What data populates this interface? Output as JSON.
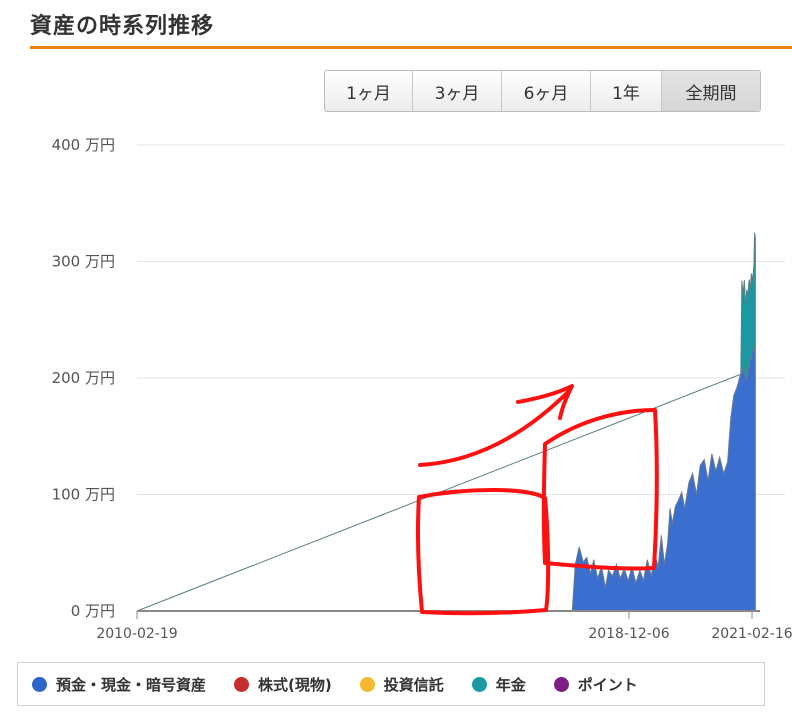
{
  "page": {
    "title": "資産の時系列推移"
  },
  "range_selector": {
    "options": [
      {
        "label": "1ヶ月",
        "active": false
      },
      {
        "label": "3ヶ月",
        "active": false
      },
      {
        "label": "6ヶ月",
        "active": false
      },
      {
        "label": "1年",
        "active": false
      },
      {
        "label": "全期間",
        "active": true
      }
    ]
  },
  "legend": {
    "items": [
      {
        "label": "預金・現金・暗号資産",
        "color": "#2f64c8"
      },
      {
        "label": "株式(現物)",
        "color": "#c62d2d"
      },
      {
        "label": "投資信託",
        "color": "#f5b82e"
      },
      {
        "label": "年金",
        "color": "#1a9aa0"
      },
      {
        "label": "ポイント",
        "color": "#7a1f86"
      }
    ]
  },
  "chart_data": {
    "type": "area",
    "stacked": true,
    "y_unit": "万円",
    "ylim": [
      0,
      400
    ],
    "y_ticks": [
      {
        "value": 0,
        "label": "0 万円"
      },
      {
        "value": 100,
        "label": "100 万円"
      },
      {
        "value": 200,
        "label": "200 万円"
      },
      {
        "value": 300,
        "label": "300 万円"
      },
      {
        "value": 400,
        "label": "400 万円"
      }
    ],
    "x_ticks": [
      "2010-02-19",
      "2018-12-06",
      "2021-02-16"
    ],
    "xlim": [
      "2010-02-19",
      "2021-03-10"
    ],
    "grid": true,
    "series": [
      {
        "name": "預金・現金・暗号資産",
        "color": "#3a6fcf",
        "points": [
          [
            "2010-02-19",
            0
          ],
          [
            "2017-12-01",
            0
          ],
          [
            "2017-12-20",
            40
          ],
          [
            "2018-01-15",
            55
          ],
          [
            "2018-02-10",
            42
          ],
          [
            "2018-03-05",
            46
          ],
          [
            "2018-03-30",
            32
          ],
          [
            "2018-04-20",
            44
          ],
          [
            "2018-05-15",
            28
          ],
          [
            "2018-06-10",
            38
          ],
          [
            "2018-07-05",
            20
          ],
          [
            "2018-07-25",
            35
          ],
          [
            "2018-08-20",
            30
          ],
          [
            "2018-09-15",
            40
          ],
          [
            "2018-10-10",
            28
          ],
          [
            "2018-11-05",
            36
          ],
          [
            "2018-12-01",
            26
          ],
          [
            "2018-12-25",
            38
          ],
          [
            "2019-01-20",
            24
          ],
          [
            "2019-02-15",
            35
          ],
          [
            "2019-03-10",
            26
          ],
          [
            "2019-04-05",
            44
          ],
          [
            "2019-04-30",
            30
          ],
          [
            "2019-05-25",
            48
          ],
          [
            "2019-06-15",
            38
          ],
          [
            "2019-07-05",
            65
          ],
          [
            "2019-07-25",
            40
          ],
          [
            "2019-08-15",
            58
          ],
          [
            "2019-08-31",
            88
          ],
          [
            "2019-09-15",
            75
          ],
          [
            "2019-10-05",
            90
          ],
          [
            "2019-10-25",
            95
          ],
          [
            "2019-11-15",
            102
          ],
          [
            "2019-12-05",
            88
          ],
          [
            "2020-01-01",
            110
          ],
          [
            "2020-01-25",
            118
          ],
          [
            "2020-02-20",
            100
          ],
          [
            "2020-03-15",
            125
          ],
          [
            "2020-04-10",
            130
          ],
          [
            "2020-05-05",
            112
          ],
          [
            "2020-05-30",
            135
          ],
          [
            "2020-06-25",
            120
          ],
          [
            "2020-07-20",
            132
          ],
          [
            "2020-08-15",
            118
          ],
          [
            "2020-09-10",
            128
          ],
          [
            "2020-09-30",
            165
          ],
          [
            "2020-10-20",
            185
          ],
          [
            "2020-11-10",
            192
          ],
          [
            "2020-12-01",
            202
          ],
          [
            "2020-12-20",
            208
          ],
          [
            "2021-01-10",
            198
          ],
          [
            "2021-01-30",
            212
          ],
          [
            "2021-02-16",
            222
          ],
          [
            "2021-03-10",
            228
          ]
        ]
      },
      {
        "name": "年金",
        "color": "#1a9aa0",
        "points": [
          [
            "2010-02-19",
            0
          ],
          [
            "2020-12-05",
            0
          ],
          [
            "2020-12-12",
            78
          ],
          [
            "2020-12-20",
            64
          ],
          [
            "2020-12-28",
            80
          ],
          [
            "2021-01-05",
            60
          ],
          [
            "2021-01-12",
            76
          ],
          [
            "2021-01-20",
            66
          ],
          [
            "2021-01-28",
            74
          ],
          [
            "2021-02-05",
            62
          ],
          [
            "2021-02-12",
            70
          ],
          [
            "2021-02-20",
            60
          ],
          [
            "2021-03-01",
            72
          ],
          [
            "2021-03-05",
            98
          ],
          [
            "2021-03-10",
            92
          ]
        ]
      }
    ]
  }
}
